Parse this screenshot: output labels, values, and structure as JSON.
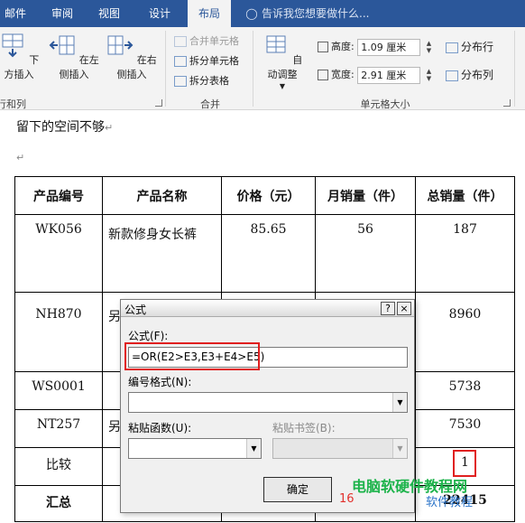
{
  "ribbon": {
    "tabs": [
      {
        "label": "邮件",
        "active": false
      },
      {
        "label": "审阅",
        "active": false
      },
      {
        "label": "视图",
        "active": false
      },
      {
        "label": "设计",
        "active": false
      },
      {
        "label": "布局",
        "active": true
      }
    ],
    "tell_me": "告诉我您想要做什么...",
    "rows_cols": {
      "insert_below": "下方插入",
      "insert_left": "在左侧插入",
      "insert_right": "在右侧插入",
      "group_label": "行和列"
    },
    "merge": {
      "merge_cells": "合并单元格",
      "split_cells": "拆分单元格",
      "split_table": "拆分表格",
      "group_label": "合并"
    },
    "cell_size": {
      "autofit": "自动调整",
      "height_label": "高度:",
      "height_value": "1.09 厘米",
      "width_label": "宽度:",
      "width_value": "2.91 厘米",
      "distribute_rows": "分布行",
      "distribute_cols": "分布列",
      "group_label": "单元格大小"
    }
  },
  "document": {
    "line1": "留下的空间不够",
    "table": {
      "headers": [
        "产品编号",
        "产品名称",
        "价格（元）",
        "月销量（件）",
        "总销量（件）"
      ],
      "rows": [
        [
          "WK056",
          "新款修身女长裤",
          "85.65",
          "56",
          "187"
        ],
        [
          "NH870",
          "另",
          "",
          "",
          "8960"
        ],
        [
          "WS0001",
          "",
          "",
          "",
          "5738"
        ],
        [
          "NT257",
          "另",
          "",
          "",
          "7530"
        ],
        [
          "比较",
          "",
          "",
          "",
          "1"
        ],
        [
          "汇总",
          "",
          "",
          "",
          "22415"
        ]
      ]
    }
  },
  "dialog": {
    "title": "公式",
    "help_btn": "?",
    "close_btn": "×",
    "formula_label": "公式(F):",
    "formula_value": "=OR(E2>E3,E3+E4>E5)",
    "number_format_label": "编号格式(N):",
    "number_format_value": "",
    "paste_function_label": "粘贴函数(U):",
    "paste_bookmark_label": "粘贴书签(B):",
    "ok_label": "确定"
  },
  "watermark": {
    "line1": "电脑软硬件教程网",
    "line2": "16",
    "line3": "软件教程"
  },
  "colors": {
    "ribbon_blue": "#2b579a",
    "highlight_red": "#e02020",
    "link_blue": "#2a7ab8"
  }
}
